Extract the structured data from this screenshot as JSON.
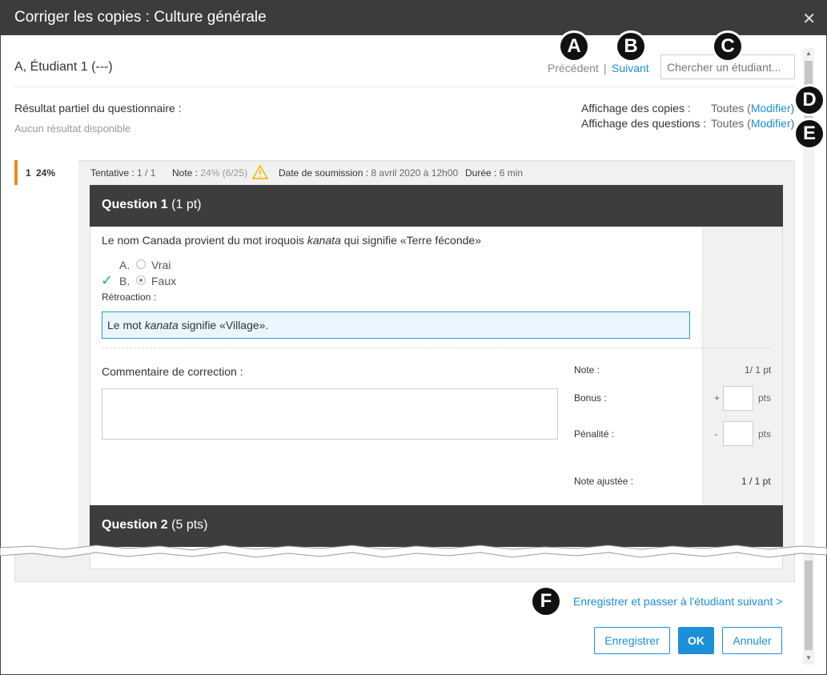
{
  "dialog": {
    "title": "Corriger les copies : Culture générale",
    "close_glyph": "✕"
  },
  "student": {
    "name": "A, Étudiant 1 (---)",
    "prev_label": "Précédent",
    "separator": "|",
    "next_label": "Suivant",
    "search_placeholder": "Chercher un étudiant..."
  },
  "summary": {
    "partial_label": "Résultat partiel du questionnaire :",
    "partial_value": "Aucun résultat disponible",
    "copies_label": "Affichage des copies :",
    "copies_value": "Toutes",
    "questions_label": "Affichage des questions :",
    "questions_value": "Toutes",
    "modify_label": "Modifier",
    "paren_open": "(",
    "paren_close": ")"
  },
  "attempt": {
    "number": "1",
    "percent": "24%",
    "tentative_label": "Tentative :",
    "tentative_value": "1 / 1",
    "note_label": "Note :",
    "note_percent": "24%",
    "note_detail": "(6/25)",
    "date_label": "Date de soumission :",
    "date_value": "8 avril 2020 à 12h00",
    "duration_label": "Durée :",
    "duration_value": "6 min"
  },
  "question1": {
    "title": "Question 1",
    "points": "(1 pt)",
    "text_before": "Le nom Canada provient du mot iroquois ",
    "text_em": "kanata",
    "text_after": " qui signifie «Terre féconde»",
    "options": [
      {
        "letter": "A.",
        "label": "Vrai",
        "selected": false,
        "correct": false
      },
      {
        "letter": "B.",
        "label": "Faux",
        "selected": true,
        "correct": true
      }
    ],
    "correct_mark": "✓",
    "feedback_label": "Rétroaction :",
    "feedback_before": "Le mot ",
    "feedback_em": "kanata",
    "feedback_after": " signifie «Village».",
    "comment_label": "Commentaire de correction :",
    "note_label": "Note :",
    "note_value": "1/ 1 pt",
    "bonus_label": "Bonus :",
    "bonus_sign": "+",
    "penalty_label": "Pénalité :",
    "penalty_sign": "-",
    "pts_unit": "pts",
    "adjusted_label": "Note ajustée :",
    "adjusted_value": "1 / 1 pt"
  },
  "question2": {
    "title": "Question 2",
    "points": "(5 pts)"
  },
  "footer": {
    "save_next_label": "Enregistrer et passer à l'étudiant suivant >",
    "save_label": "Enregistrer",
    "ok_label": "OK",
    "cancel_label": "Annuler"
  },
  "callouts": [
    "A",
    "B",
    "C",
    "D",
    "E",
    "F"
  ],
  "colors": {
    "accent": "#1d8fd8",
    "header": "#3c3c3c",
    "attempt_marker": "#f0861e",
    "correct": "#2eb15a",
    "warning": "#f5b400"
  }
}
